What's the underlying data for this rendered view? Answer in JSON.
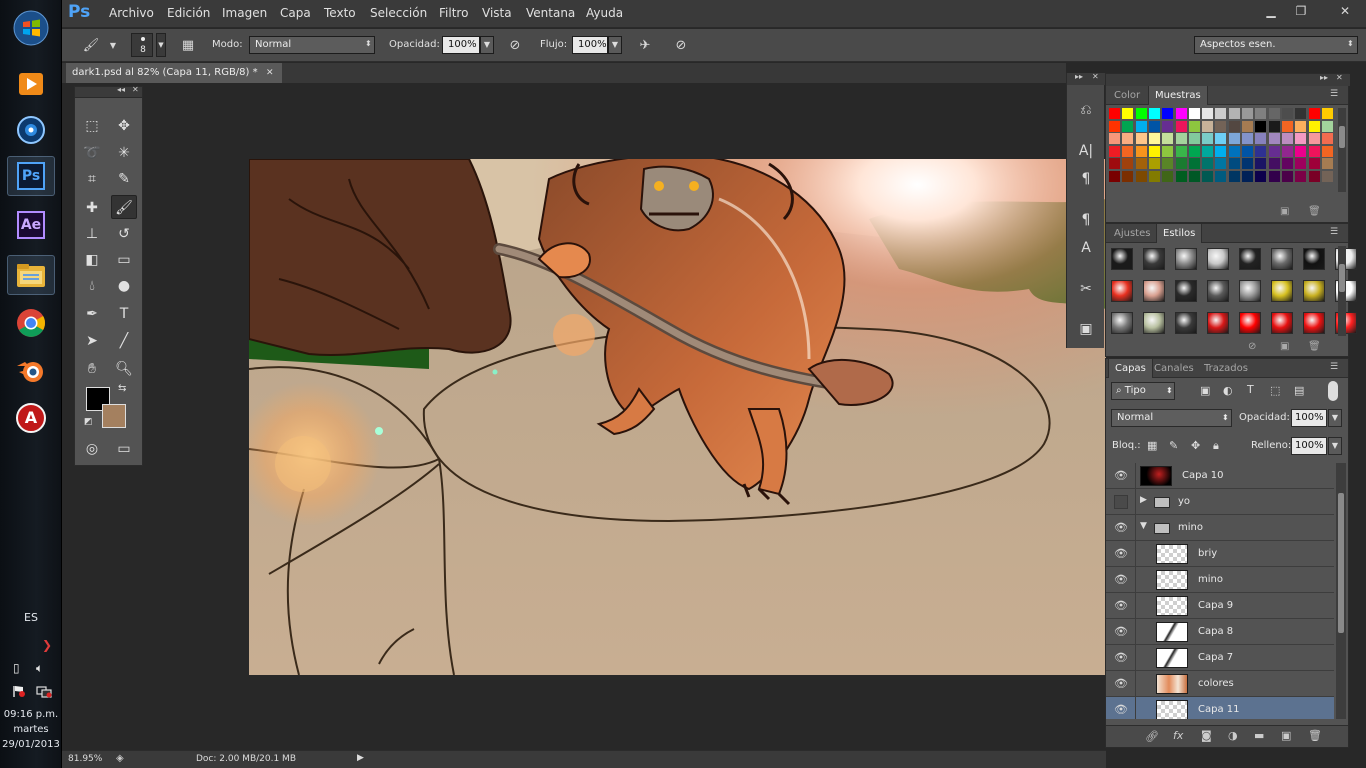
{
  "taskbar": {
    "language": "ES",
    "time": "09:16 p.m.",
    "weekday": "martes",
    "date": "29/01/2013",
    "apps": [
      {
        "name": "windows-start-icon"
      },
      {
        "name": "media-player-icon"
      },
      {
        "name": "media-center-icon"
      },
      {
        "name": "photoshop-icon",
        "label": "Ps"
      },
      {
        "name": "after-effects-icon",
        "label": "Ae"
      },
      {
        "name": "file-explorer-icon"
      },
      {
        "name": "chrome-icon"
      },
      {
        "name": "blender-icon"
      },
      {
        "name": "app-a-icon",
        "label": "A"
      }
    ]
  },
  "menubar": {
    "logo": "Ps",
    "items": [
      "Archivo",
      "Edición",
      "Imagen",
      "Capa",
      "Texto",
      "Selección",
      "Filtro",
      "Vista",
      "Ventana",
      "Ayuda"
    ],
    "minimize": "▁",
    "restore": "❐",
    "close": "✕"
  },
  "options": {
    "brush_size": "8",
    "mode_label": "Modo:",
    "mode_value": "Normal",
    "opacity_label": "Opacidad:",
    "opacity_value": "100%",
    "flow_label": "Flujo:",
    "flow_value": "100%",
    "workspace_value": "Aspectos esen."
  },
  "document": {
    "tab_title": "dark1.psd al 82% (Capa 11, RGB/8) *",
    "tab_close": "✕"
  },
  "status": {
    "zoom": "81.95%",
    "doc_info": "Doc: 2.00 MB/20.1 MB"
  },
  "panels": {
    "color_tabs": [
      "Color",
      "Muestras"
    ],
    "adjust_tabs": [
      "Ajustes",
      "Estilos"
    ],
    "layer_tabs": [
      "Capas",
      "Canales",
      "Trazados"
    ],
    "filter_kind": "Tipo",
    "blend_mode": "Normal",
    "opacity_label": "Opacidad:",
    "opacity_value": "100%",
    "lock_label": "Bloq.:",
    "fill_label": "Relleno:",
    "fill_value": "100%",
    "swatch_colors": [
      [
        "#ff0000",
        "#ffff00",
        "#00ff00",
        "#00ffff",
        "#0000ff",
        "#ff00ff",
        "#ffffff",
        "#e6e6e6",
        "#cccccc",
        "#b3b3b3",
        "#999999",
        "#808080",
        "#666666",
        "#4d4d4d",
        "#333333",
        "#ff0000",
        "#ffcc00"
      ],
      [
        "#ff3300",
        "#00a651",
        "#00aeef",
        "#0054a6",
        "#662d91",
        "#ed145b",
        "#8dc63f",
        "#c7b299",
        "#736357",
        "#534741",
        "#a67c52",
        "#000000",
        "#1a1a1a",
        "#f26522",
        "#fbaf5d",
        "#fff200",
        "#a3d39c"
      ],
      [
        "#f7977a",
        "#f9ad81",
        "#fdc68a",
        "#fff79a",
        "#c4df9b",
        "#a3d39c",
        "#82ca9c",
        "#7accc8",
        "#6dcff6",
        "#7da7d9",
        "#8393ca",
        "#8781bd",
        "#a187be",
        "#bc8dbf",
        "#f49ac2",
        "#f6989d",
        "#f26c4f"
      ],
      [
        "#ed1c24",
        "#f26522",
        "#f7941d",
        "#fff200",
        "#8dc63f",
        "#39b54a",
        "#00a651",
        "#00a99d",
        "#00aeef",
        "#0072bc",
        "#0054a6",
        "#2e3192",
        "#662d91",
        "#92278f",
        "#ec008c",
        "#ed145b",
        "#f26522"
      ],
      [
        "#9e0b0f",
        "#a0410d",
        "#a36209",
        "#aba000",
        "#598527",
        "#1a7b30",
        "#007236",
        "#00746b",
        "#0076a3",
        "#004b80",
        "#003471",
        "#1b1464",
        "#440e62",
        "#630460",
        "#9e005d",
        "#9e0039",
        "#a67c52"
      ],
      [
        "#790000",
        "#7b2e00",
        "#7d4900",
        "#827b00",
        "#406618",
        "#005e20",
        "#005826",
        "#005952",
        "#005b7f",
        "#003663",
        "#002157",
        "#0d004c",
        "#32004b",
        "#4b0049",
        "#7b0046",
        "#7a0026",
        "#736357"
      ]
    ]
  },
  "layers": [
    {
      "name": "Capa 10",
      "visible": true,
      "indent": 0,
      "kind": "layer",
      "thumb": "dark"
    },
    {
      "name": "yo",
      "visible": false,
      "indent": 0,
      "kind": "group",
      "expanded": false
    },
    {
      "name": "mino",
      "visible": true,
      "indent": 0,
      "kind": "group",
      "expanded": true
    },
    {
      "name": "briy",
      "visible": true,
      "indent": 1,
      "kind": "layer",
      "thumb": "empty"
    },
    {
      "name": "mino",
      "visible": true,
      "indent": 1,
      "kind": "layer",
      "thumb": "empty"
    },
    {
      "name": "Capa 9",
      "visible": true,
      "indent": 1,
      "kind": "layer",
      "thumb": "empty"
    },
    {
      "name": "Capa 8",
      "visible": true,
      "indent": 1,
      "kind": "layer",
      "thumb": "sketch"
    },
    {
      "name": "Capa 7",
      "visible": true,
      "indent": 1,
      "kind": "layer",
      "thumb": "sketch"
    },
    {
      "name": "colores",
      "visible": true,
      "indent": 1,
      "kind": "layer",
      "thumb": "color"
    },
    {
      "name": "Capa 11",
      "visible": true,
      "indent": 1,
      "kind": "layer",
      "thumb": "empty",
      "selected": true
    }
  ],
  "colors": {
    "foreground": "#000000",
    "background": "#a4805f",
    "accent": "#5c7290"
  }
}
